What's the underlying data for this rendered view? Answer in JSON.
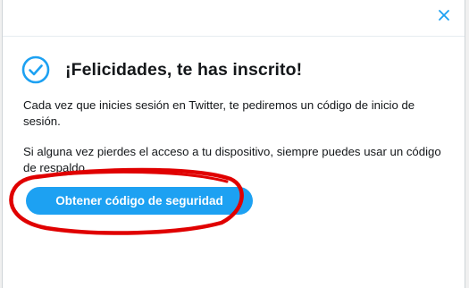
{
  "dialog": {
    "close_icon": "close-icon",
    "success_icon": "checkmark-circle-icon",
    "title": "¡Felicidades, te has inscrito!",
    "paragraph_1": "Cada vez que inicies sesión en Twitter, te pediremos un código de inicio de sesión.",
    "paragraph_2": "Si alguna vez pierdes el acceso a tu dispositivo, siempre puedes usar un código de respaldo.",
    "button_label": "Obtener código de seguridad"
  },
  "colors": {
    "accent": "#1da1f2",
    "text": "#14171a",
    "annotation": "#e00000"
  }
}
